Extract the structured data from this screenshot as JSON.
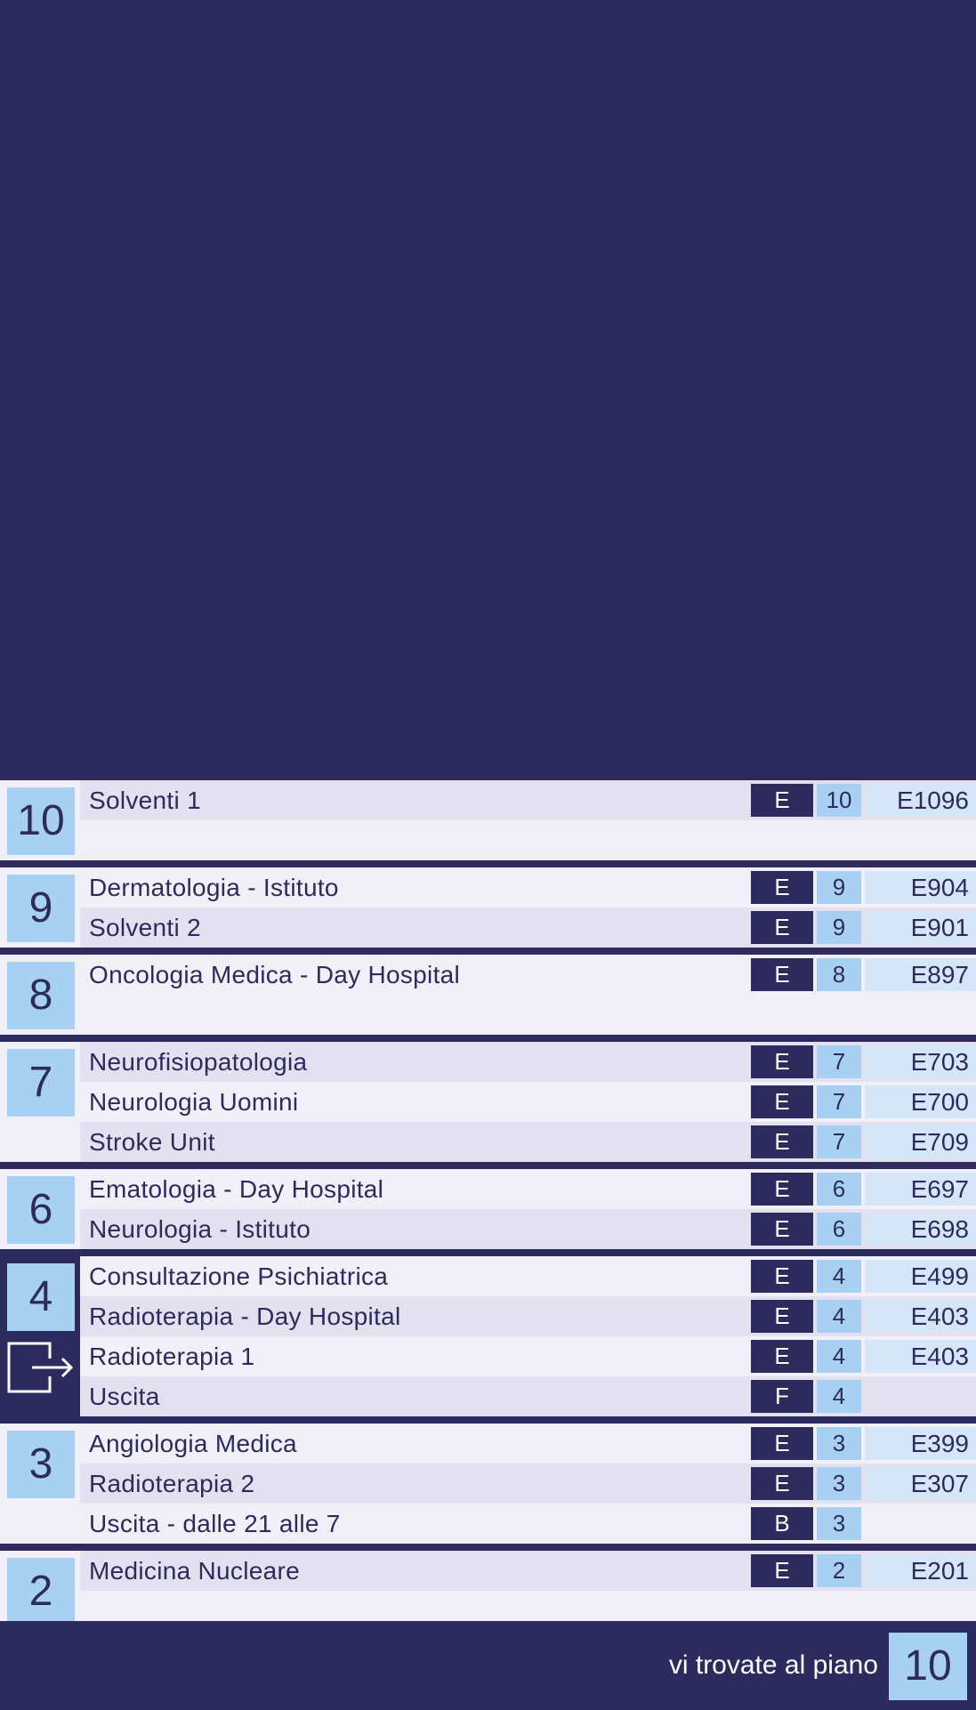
{
  "hero": {},
  "floors": [
    {
      "number": "10",
      "rows": [
        {
          "name": "Solventi 1",
          "building": "E",
          "level": "10",
          "room": "E1096"
        }
      ]
    },
    {
      "number": "9",
      "rows": [
        {
          "name": "Dermatologia - Istituto",
          "building": "E",
          "level": "9",
          "room": "E904"
        },
        {
          "name": "Solventi 2",
          "building": "E",
          "level": "9",
          "room": "E901"
        }
      ]
    },
    {
      "number": "8",
      "rows": [
        {
          "name": "Oncologia Medica - Day Hospital",
          "building": "E",
          "level": "8",
          "room": "E897"
        }
      ]
    },
    {
      "number": "7",
      "rows": [
        {
          "name": "Neurofisiopatologia",
          "building": "E",
          "level": "7",
          "room": "E703"
        },
        {
          "name": "Neurologia Uomini",
          "building": "E",
          "level": "7",
          "room": "E700"
        },
        {
          "name": "Stroke Unit",
          "building": "E",
          "level": "7",
          "room": "E709"
        }
      ]
    },
    {
      "number": "6",
      "rows": [
        {
          "name": "Ematologia - Day Hospital",
          "building": "E",
          "level": "6",
          "room": "E697"
        },
        {
          "name": "Neurologia - Istituto",
          "building": "E",
          "level": "6",
          "room": "E698"
        }
      ]
    },
    {
      "number": "4",
      "has_exit_icon": true,
      "rows": [
        {
          "name": "Consultazione Psichiatrica",
          "building": "E",
          "level": "4",
          "room": "E499"
        },
        {
          "name": "Radioterapia - Day Hospital",
          "building": "E",
          "level": "4",
          "room": "E403"
        },
        {
          "name": "Radioterapia 1",
          "building": "E",
          "level": "4",
          "room": "E403"
        },
        {
          "name": "Uscita",
          "building": "F",
          "level": "4",
          "room": ""
        }
      ]
    },
    {
      "number": "3",
      "rows": [
        {
          "name": "Angiologia Medica",
          "building": "E",
          "level": "3",
          "room": "E399"
        },
        {
          "name": "Radioterapia 2",
          "building": "E",
          "level": "3",
          "room": "E307"
        },
        {
          "name": "Uscita - dalle 21 alle 7",
          "building": "B",
          "level": "3",
          "room": ""
        }
      ]
    },
    {
      "number": "2",
      "rows": [
        {
          "name": "Medicina Nucleare",
          "building": "E",
          "level": "2",
          "room": "E201"
        }
      ]
    }
  ],
  "footer": {
    "label": "vi trovate al piano",
    "current_floor": "10"
  },
  "icons": {
    "exit": "exit-arrow-icon"
  },
  "colors": {
    "navy": "#2d2b5e",
    "light_blue": "#a8d0f2",
    "pale_blue": "#d5e6f8",
    "row_light": "#f1f0f8",
    "row_alt": "#e3e1ef"
  }
}
